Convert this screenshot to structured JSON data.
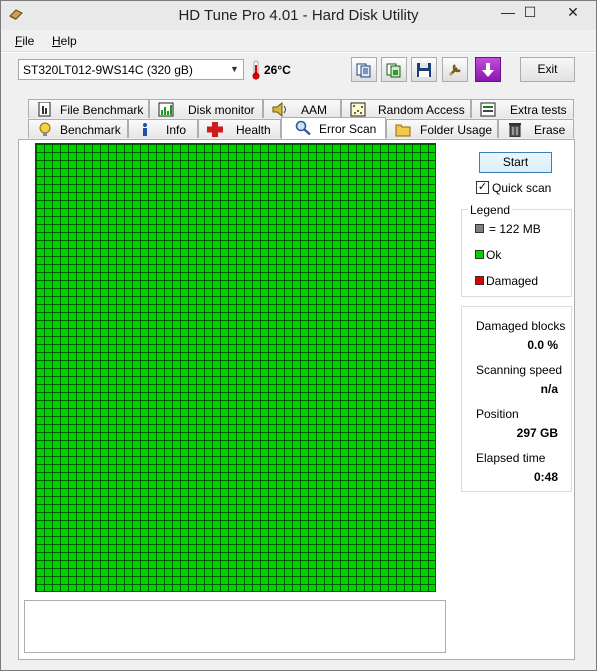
{
  "window": {
    "title": "HD Tune Pro 4.01 - Hard Disk Utility"
  },
  "menu": {
    "file": "File",
    "help": "Help"
  },
  "drive": {
    "selected": "ST320LT012-9WS14C (320 gB)",
    "temperature": "26°C"
  },
  "toolbar": {
    "exit_label": "Exit"
  },
  "tabs_top": [
    {
      "label": "File Benchmark",
      "icon": "file-benchmark-icon"
    },
    {
      "label": "Disk monitor",
      "icon": "disk-monitor-icon"
    },
    {
      "label": "AAM",
      "icon": "speaker-icon"
    },
    {
      "label": "Random Access",
      "icon": "random-access-icon"
    },
    {
      "label": "Extra tests",
      "icon": "extra-tests-icon"
    }
  ],
  "tabs_bottom": [
    {
      "label": "Benchmark",
      "icon": "lightbulb-icon"
    },
    {
      "label": "Info",
      "icon": "info-icon"
    },
    {
      "label": "Health",
      "icon": "health-cross-icon"
    },
    {
      "label": "Error Scan",
      "icon": "magnifier-icon",
      "active": true
    },
    {
      "label": "Folder Usage",
      "icon": "folder-icon"
    },
    {
      "label": "Erase",
      "icon": "trash-icon"
    }
  ],
  "scan": {
    "start_label": "Start",
    "quick_scan_label": "Quick scan",
    "quick_scan_checked": true,
    "block_state": "all-ok"
  },
  "legend": {
    "title": "Legend",
    "block_size": "= 122 MB",
    "ok": "Ok",
    "damaged": "Damaged",
    "colors": {
      "block": "#808080",
      "ok": "#00d400",
      "damaged": "#e00000"
    }
  },
  "stats": {
    "damaged_blocks_label": "Damaged blocks",
    "damaged_blocks_value": "0.0 %",
    "scanning_speed_label": "Scanning speed",
    "scanning_speed_value": "n/a",
    "position_label": "Position",
    "position_value": "297 GB",
    "elapsed_label": "Elapsed time",
    "elapsed_value": "0:48"
  }
}
